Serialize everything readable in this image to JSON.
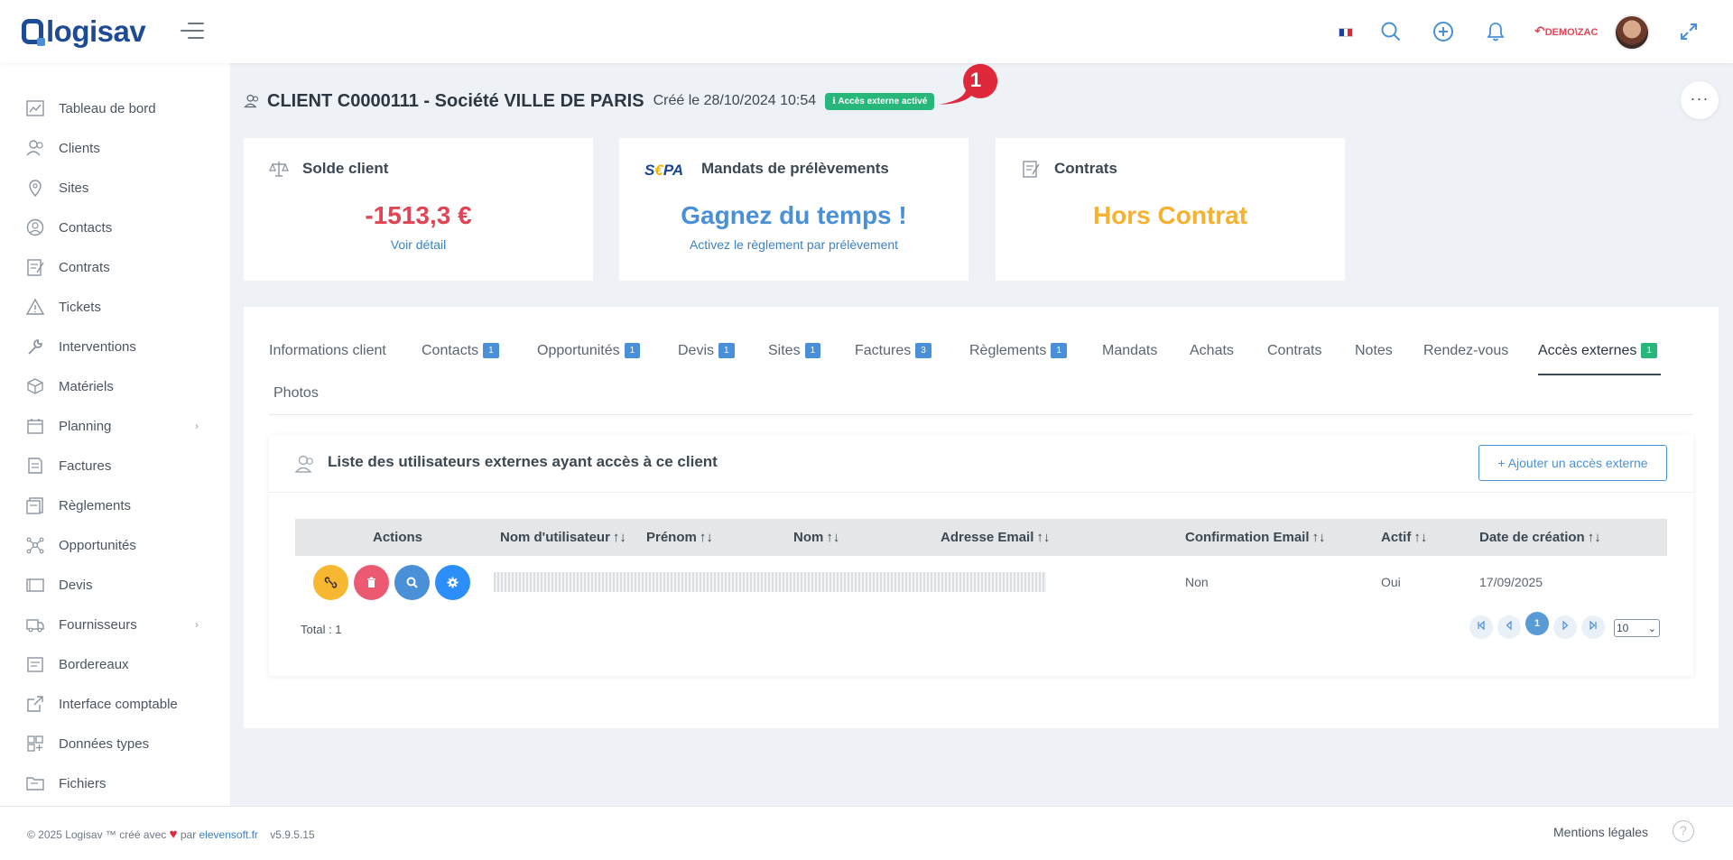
{
  "brand": {
    "name": "logisav"
  },
  "topbar": {
    "user_label": "DEMO\\ZAC",
    "icons": [
      "flag-fr-icon",
      "search-icon",
      "plus-circle-icon",
      "bell-icon",
      "expand-icon"
    ]
  },
  "sidebar": {
    "items": [
      {
        "label": "Tableau de bord",
        "icon": "dashboard-icon"
      },
      {
        "label": "Clients",
        "icon": "users-icon"
      },
      {
        "label": "Sites",
        "icon": "location-icon"
      },
      {
        "label": "Contacts",
        "icon": "contacts-icon"
      },
      {
        "label": "Contrats",
        "icon": "contract-icon"
      },
      {
        "label": "Tickets",
        "icon": "warning-icon"
      },
      {
        "label": "Interventions",
        "icon": "wrench-icon"
      },
      {
        "label": "Matériels",
        "icon": "box-icon"
      },
      {
        "label": "Planning",
        "icon": "calendar-icon"
      },
      {
        "label": "Factures",
        "icon": "invoice-icon"
      },
      {
        "label": "Règlements",
        "icon": "payment-icon"
      },
      {
        "label": "Opportunités",
        "icon": "opportunity-icon"
      },
      {
        "label": "Devis",
        "icon": "quote-icon"
      },
      {
        "label": "Fournisseurs",
        "icon": "truck-icon"
      },
      {
        "label": "Bordereaux",
        "icon": "slip-icon"
      },
      {
        "label": "Interface comptable",
        "icon": "external-link-icon"
      },
      {
        "label": "Données types",
        "icon": "grid-icon"
      },
      {
        "label": "Fichiers",
        "icon": "folder-icon"
      }
    ]
  },
  "page": {
    "title": "CLIENT C0000111 - Société VILLE DE PARIS",
    "created": "Créé le 28/10/2024 10:54",
    "external_badge": "Accès externe activé",
    "callout_number": "1",
    "more_label": "···"
  },
  "cards": {
    "balance": {
      "title": "Solde client",
      "value": "-1513,3 €",
      "link": "Voir détail",
      "value_color": "#e04455"
    },
    "sepa": {
      "logo_s": "S",
      "logo_e": "€",
      "logo_rest": "PA",
      "title": "Mandats de prélèvements",
      "value": "Gagnez du temps !",
      "link": "Activez le règlement par prélèvement",
      "value_color": "#4a90d9"
    },
    "contracts": {
      "title": "Contrats",
      "value": "Hors Contrat",
      "value_color": "#f5b230"
    }
  },
  "tabs": [
    {
      "label": "Informations client",
      "count": ""
    },
    {
      "label": "Contacts",
      "count": "1"
    },
    {
      "label": "Opportunités",
      "count": "1"
    },
    {
      "label": "Devis",
      "count": "1"
    },
    {
      "label": "Sites",
      "count": "1"
    },
    {
      "label": "Factures",
      "count": "3"
    },
    {
      "label": "Règlements",
      "count": "1"
    },
    {
      "label": "Mandats",
      "count": ""
    },
    {
      "label": "Achats",
      "count": ""
    },
    {
      "label": "Contrats",
      "count": ""
    },
    {
      "label": "Notes",
      "count": ""
    },
    {
      "label": "Rendez-vous",
      "count": ""
    },
    {
      "label": "Accès externes",
      "count": "1"
    },
    {
      "label": "Photos",
      "count": ""
    }
  ],
  "active_tab": "Accès externes",
  "list": {
    "title": "Liste des utilisateurs externes ayant accès à ce client",
    "add_button": "+ Ajouter un accès externe",
    "columns": [
      "Actions",
      "Nom d'utilisateur",
      "Prénom",
      "Nom",
      "Adresse Email",
      "Confirmation Email",
      "Actif",
      "Date de création"
    ],
    "sort_glyph": "↑↓",
    "rows": [
      {
        "confirmation_email": "Non",
        "actif": "Oui",
        "date_creation": "17/09/2025"
      }
    ],
    "total": "Total : 1",
    "pagination": {
      "current": "1",
      "page_size": "10"
    }
  },
  "footer": {
    "copyright": "© 2025 Logisav ™ créé avec",
    "by": "par",
    "site": "elevensoft.fr",
    "version": "v5.9.5.15",
    "legal": "Mentions légales",
    "help": "?"
  }
}
